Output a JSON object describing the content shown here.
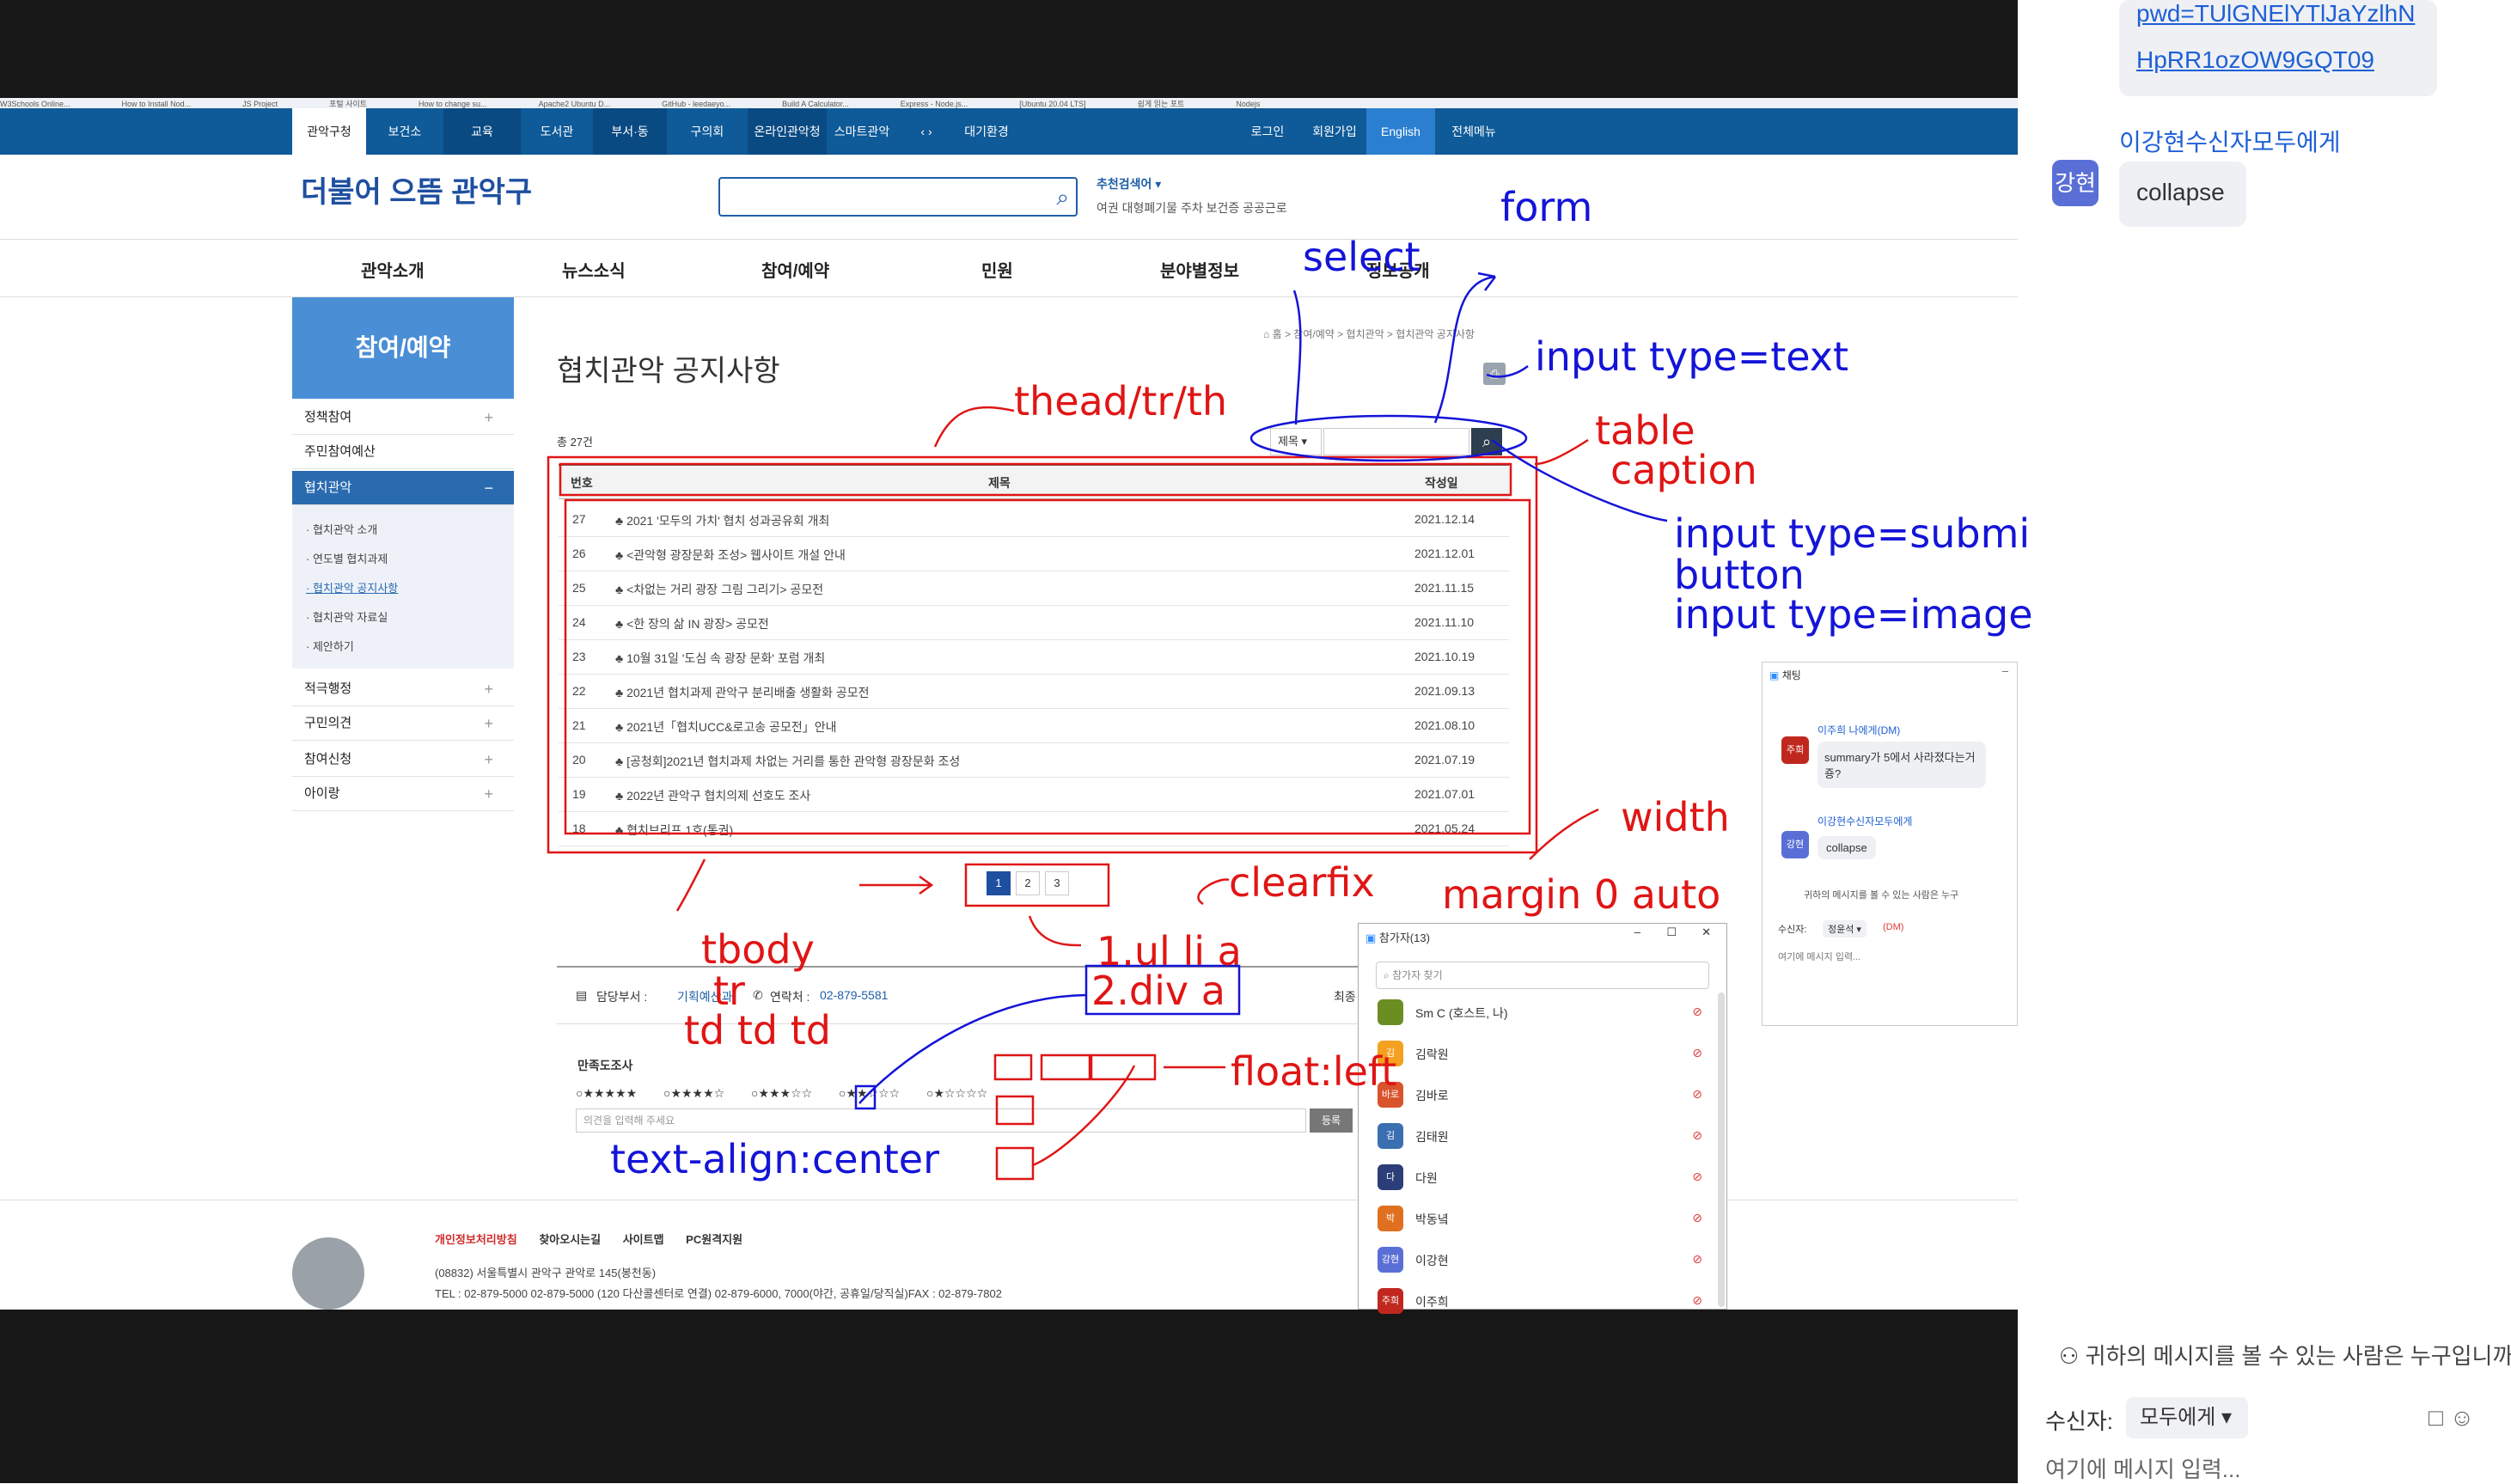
{
  "bookmarks": [
    "W3Schools Online...",
    "How to Install Nod...",
    "JS Project",
    "포털 사이트",
    "How to change su...",
    "Apache2 Ubuntu D...",
    "GitHub - leedaeyo...",
    "Build A Calculator...",
    "Express - Node.js...",
    "[Ubuntu 20.04 LTS]",
    "쉽게 읽는 포트",
    "Nodejs"
  ],
  "gov_nav": {
    "tabs": [
      "관악구청",
      "보건소",
      "교육",
      "도서관",
      "부서·동",
      "구의회",
      "온라인관악청",
      "스마트관악",
      "‹ ›",
      "대기환경"
    ],
    "right": [
      "로그인",
      "회원가입",
      "English",
      "전체메뉴"
    ]
  },
  "header": {
    "logo": "더불어 으뜸 관악구",
    "reco_title": "추천검색어 ▾",
    "reco_text": "여권 대형폐기물 주차 보건증 공공근로"
  },
  "main_nav": [
    "관악소개",
    "뉴스소식",
    "참여/예약",
    "민원",
    "분야별정보",
    "정보공개"
  ],
  "sidebar": {
    "title": "참여/예약",
    "items": [
      {
        "label": "정책참여",
        "pm": "+"
      },
      {
        "label": "주민참여예산",
        "pm": ""
      },
      {
        "label": "협치관악",
        "pm": "−"
      }
    ],
    "sub": [
      "· 협치관악 소개",
      "· 연도별 협치과제",
      "· 협치관악 공지사항",
      "· 협치관악 자료실",
      "· 제안하기"
    ],
    "items2": [
      {
        "label": "적극행정",
        "pm": "+"
      },
      {
        "label": "구민의견",
        "pm": "+"
      },
      {
        "label": "참여신청",
        "pm": "+"
      },
      {
        "label": "아이랑",
        "pm": "+"
      }
    ]
  },
  "content": {
    "breadcrumb": "⌂ 홈 > 참여/예약 > 협치관악 > 협치관악 공지사항",
    "title": "협치관악 공지사항",
    "total": "총 27건",
    "select": "제목 ▾",
    "columns": [
      "번호",
      "제목",
      "작성일"
    ],
    "rows": [
      {
        "n": "27",
        "t": "♣ 2021 '모두의 가치' 협치 성과공유회 개최",
        "d": "2021.12.14"
      },
      {
        "n": "26",
        "t": "♣ <관악형 광장문화 조성> 웹사이트 개설 안내",
        "d": "2021.12.01"
      },
      {
        "n": "25",
        "t": "♣ <차없는 거리 광장 그림 그리기> 공모전",
        "d": "2021.11.15"
      },
      {
        "n": "24",
        "t": "♣ <한 장의 삶 IN 광장> 공모전",
        "d": "2021.11.10"
      },
      {
        "n": "23",
        "t": "♣ 10월 31일 '도심 속 광장 문화' 포럼 개최",
        "d": "2021.10.19"
      },
      {
        "n": "22",
        "t": "♣ 2021년 협치과제 관악구 분리배출 생활화 공모전",
        "d": "2021.09.13"
      },
      {
        "n": "21",
        "t": "♣ 2021년「협치UCC&로고송 공모전」안내",
        "d": "2021.08.10"
      },
      {
        "n": "20",
        "t": "♣ [공청회]2021년 협치과제 차없는 거리를 통한 관악형 광장문화 조성",
        "d": "2021.07.19"
      },
      {
        "n": "19",
        "t": "♣ 2022년 관악구 협치의제 선호도 조사",
        "d": "2021.07.01"
      },
      {
        "n": "18",
        "t": "♣ 협치브리프 1호(통권)",
        "d": "2021.05.24"
      }
    ],
    "pages": [
      "1",
      "2",
      "3"
    ],
    "dept_label": "담당부서 : ",
    "dept": "기획예산과",
    "contact_label": "연락처 : ",
    "contact": "02-879-5581",
    "updated": "최종",
    "survey_title": "만족도조사",
    "survey_opts": [
      "○★★★★★",
      "○★★★★☆",
      "○★★★☆☆",
      "○★★☆☆☆",
      "○★☆☆☆☆"
    ],
    "comment_placeholder": "의견을 입력해 주세요",
    "register": "등록"
  },
  "footer": {
    "links": [
      "개인정보처리방침",
      "찾아오시는길",
      "사이트맵",
      "PC원격지원"
    ],
    "addr": "(08832) 서울특별시 관악구 관악로 145(봉천동)",
    "tel": "TEL : 02-879-5000 02-879-5000 (120 다산콜센터로 연결) 02-879-6000, 7000(야간, 공휴일/당직실)FAX : 02-879-7802"
  },
  "chat_panel": {
    "url1": "pwd=TUlGNElYTlJaYzlhN",
    "url2": "HpRR1ozOW9GQT09",
    "from": "이강현수신자모두에게",
    "avatar": "강현",
    "collapse": "collapse",
    "visibility": "귀하의 메시지를 볼 수 있는 사람은 누구입니까",
    "to_label": "수신자:",
    "to_value": "모두에게 ▾",
    "input_placeholder": "여기에 메시지 입력...",
    "file_icon": "□",
    "emoji_icon": "☺"
  },
  "chat_window": {
    "title": "채팅",
    "msg1_from": "이주희 나에게(DM)",
    "msg1_avatar": "주희",
    "msg1_text": "summary가 5에서 사라졌다는거죵?",
    "msg2_from": "이강현수신자모두에게",
    "msg2_avatar": "강현",
    "msg2_text": "collapse",
    "visibility": "귀하의 메시지를 볼 수 있는 사람은 누구",
    "to_label": "수신자:",
    "to_value": "정윤석 ▾",
    "to_dm": "(DM)",
    "input": "여기에 메시지 입력..."
  },
  "participants": {
    "title": "참가자(13)",
    "search": "참가자 찾기",
    "list": [
      {
        "av": "",
        "name": "Sm C (호스트, 나)",
        "color": "#6b8e23"
      },
      {
        "av": "김",
        "name": "김락원",
        "color": "#f4a020"
      },
      {
        "av": "바로",
        "name": "김바로",
        "color": "#d9532c"
      },
      {
        "av": "김",
        "name": "김태원",
        "color": "#3a6fb0"
      },
      {
        "av": "다",
        "name": "다원",
        "color": "#2c3e78"
      },
      {
        "av": "박",
        "name": "박동녘",
        "color": "#e07020"
      },
      {
        "av": "강현",
        "name": "이강현",
        "color": "#5a6fd6"
      },
      {
        "av": "주희",
        "name": "이주희",
        "color": "#c0281e"
      }
    ]
  },
  "annotations": {
    "form": "form",
    "select": "select",
    "input_text": "input type=text",
    "thead": "thead/tr/th",
    "table": "table",
    "caption": "caption",
    "submit1": "input type=submi",
    "submit2": "button",
    "submit3": "input type=image",
    "width": "width",
    "margin": "margin 0 auto",
    "clearfix": "clearfix",
    "tbody": "tbody",
    "tr": "tr",
    "td": "td  td  td",
    "ul": "1.ul li a",
    "div": "2.div a",
    "float": "float:left",
    "textalign": "text-align:center"
  }
}
